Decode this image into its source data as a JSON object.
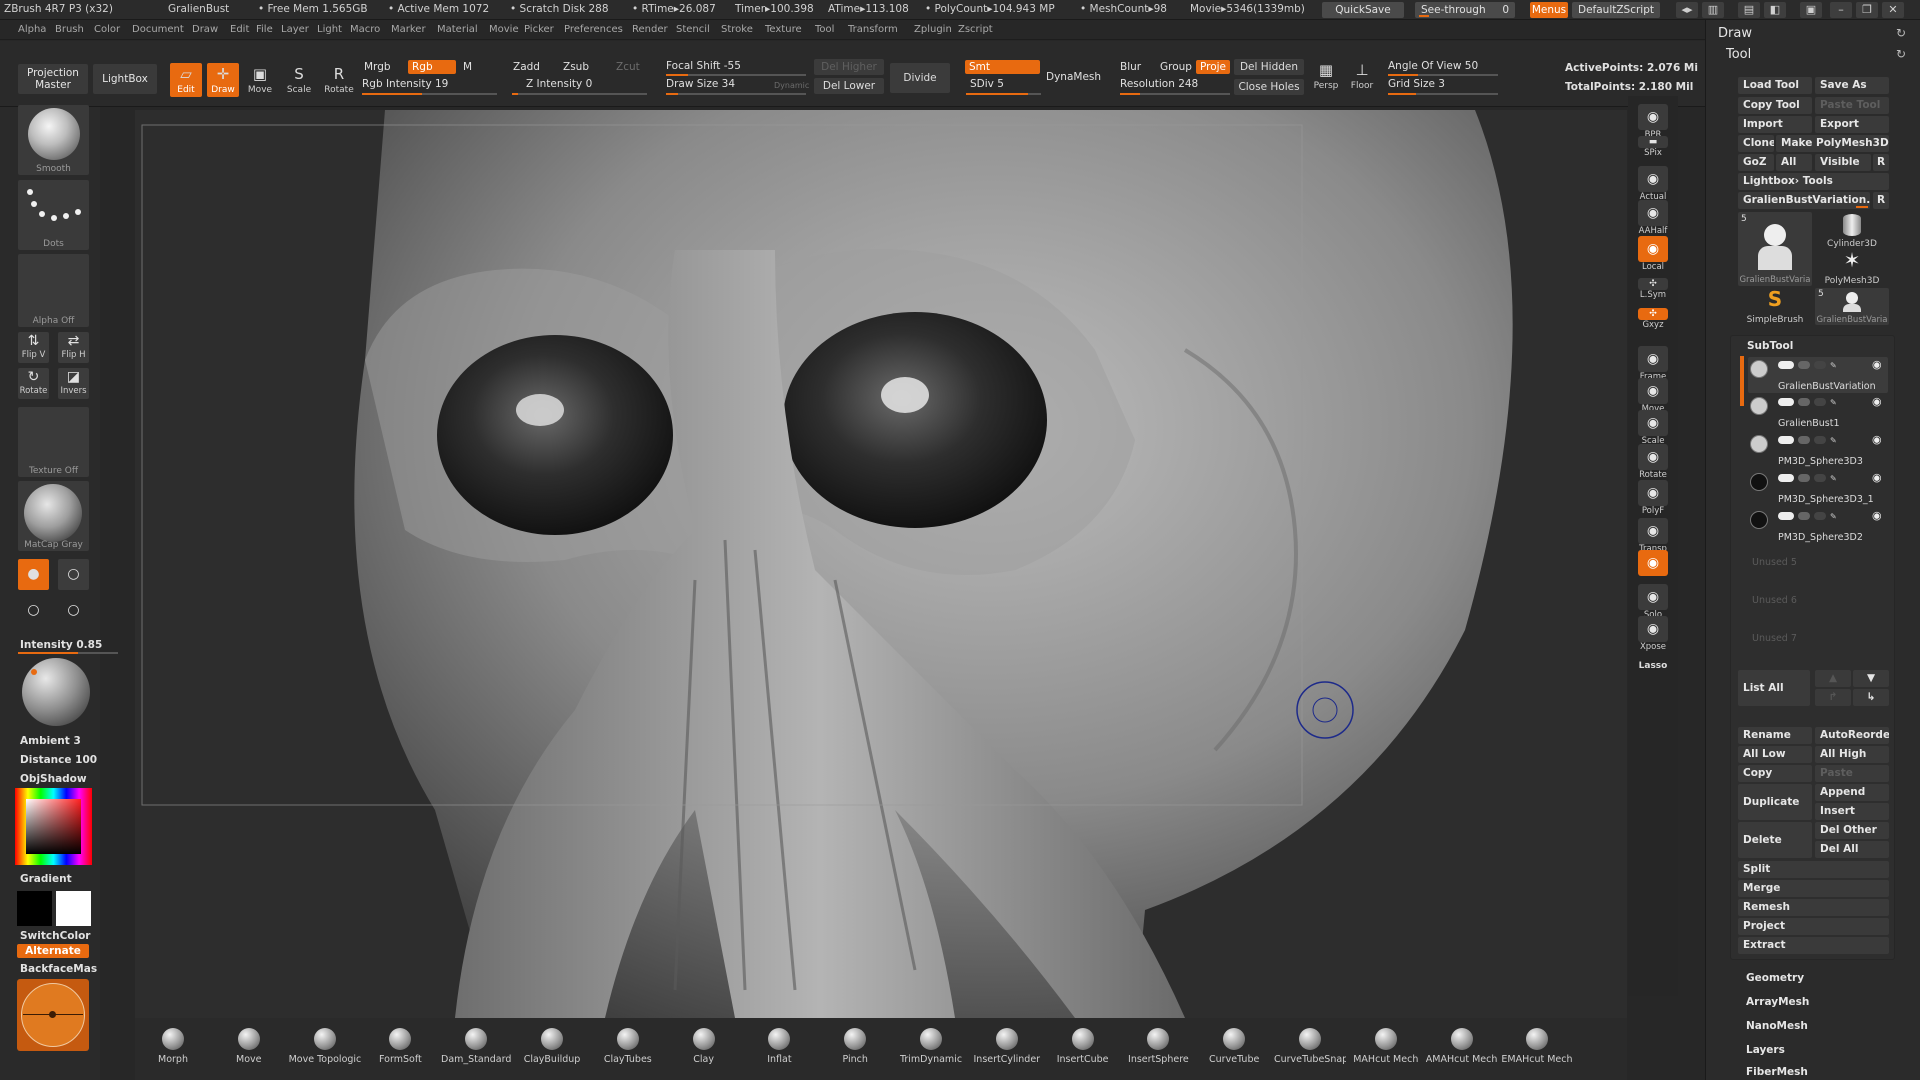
{
  "titlebar": {
    "app": "ZBrush 4R7 P3 (x32)",
    "doc": "GralienBust",
    "free_mem": "• Free Mem 1.565GB",
    "active_mem": "• Active Mem 1072",
    "scratch": "• Scratch Disk 288",
    "rtime": "• RTime▸26.087",
    "timer": "Timer▸100.398",
    "atime": "ATime▸113.108",
    "polycount": "• PolyCount▸104.943 MP",
    "meshcount": "• MeshCount▸98",
    "movie": "Movie▸5346(1339mb)",
    "quicksave": "QuickSave",
    "seethrough": "See-through",
    "seethrough_val": "0",
    "menus": "Menus",
    "zscript": "DefaultZScript"
  },
  "menubar": [
    "Alpha",
    "Brush",
    "Color",
    "Document",
    "Draw",
    "Edit",
    "File",
    "Layer",
    "Light",
    "Macro",
    "Marker",
    "Material",
    "Movie",
    "Picker",
    "Preferences",
    "Render",
    "Stencil",
    "Stroke",
    "Texture",
    "Tool",
    "Transform",
    "Zplugin",
    "Zscript"
  ],
  "topshelf": {
    "projection_master": "Projection Master",
    "lightbox": "LightBox",
    "edit": "Edit",
    "draw": "Draw",
    "move": "Move",
    "scale": "Scale",
    "rotate": "Rotate",
    "mrgb": "Mrgb",
    "rgb": "Rgb",
    "m": "M",
    "rgb_intensity": "Rgb Intensity 19",
    "zadd": "Zadd",
    "zsub": "Zsub",
    "zcut": "Zcut",
    "z_intensity": "Z Intensity 0",
    "focal_shift": "Focal Shift -55",
    "draw_size": "Draw Size 34",
    "dynamic": "Dynamic",
    "del_higher": "Del Higher",
    "del_lower": "Del Lower",
    "divide": "Divide",
    "smt": "Smt",
    "sdiv": "SDiv 5",
    "dynamesh": "DynaMesh",
    "blur": "Blur",
    "group": "Group",
    "proje": "Proje",
    "resolution": "Resolution 248",
    "del_hidden": "Del Hidden",
    "close_holes": "Close Holes",
    "persp": "Persp",
    "floor": "Floor",
    "angle_of_view": "Angle Of View 50",
    "grid_size": "Grid Size 3",
    "active_points": "ActivePoints: 2.076  Mi",
    "total_points": "TotalPoints: 2.180  Mil"
  },
  "leftpanel": {
    "smooth": "Smooth",
    "dots": "Dots",
    "alpha_off": "Alpha Off",
    "flip_v": "Flip V",
    "flip_h": "Flip H",
    "rotate": "Rotate",
    "invers": "Invers",
    "texture_off": "Texture Off",
    "matcap": "MatCap Gray",
    "intensity": "Intensity 0.85",
    "ambient": "Ambient 3",
    "distance": "Distance 100",
    "objshadow": "ObjShadow",
    "gradient": "Gradient",
    "switchcolor": "SwitchColor",
    "alternate": "Alternate",
    "backface": "BackfaceMas"
  },
  "rightshelf": [
    {
      "name": "bpr",
      "label": "BPR",
      "on": false
    },
    {
      "name": "spix",
      "label": "SPix",
      "on": false
    },
    {
      "name": "actual",
      "label": "Actual",
      "on": false
    },
    {
      "name": "aahalf",
      "label": "AAHalf",
      "on": false
    },
    {
      "name": "local",
      "label": "Local",
      "on": true
    },
    {
      "name": "lsym",
      "label": "L.Sym",
      "on": false
    },
    {
      "name": "xyz",
      "label": "Gxyz",
      "on": true
    },
    {
      "name": "frame",
      "label": "Frame",
      "on": false
    },
    {
      "name": "move",
      "label": "Move",
      "on": false
    },
    {
      "name": "scale",
      "label": "Scale",
      "on": false
    },
    {
      "name": "rotate",
      "label": "Rotate",
      "on": false
    },
    {
      "name": "polyf",
      "label": "PolyF",
      "on": false
    },
    {
      "name": "transp",
      "label": "Transp",
      "on": false
    },
    {
      "name": "ghost",
      "label": "",
      "on": true
    },
    {
      "name": "solo",
      "label": "Solo",
      "on": false
    },
    {
      "name": "xpose",
      "label": "Xpose",
      "on": false
    }
  ],
  "rightshelf_lasso": "Lasso",
  "brushes": [
    "Morph",
    "Move",
    "Move Topologic",
    "FormSoft",
    "Dam_Standard",
    "ClayBuildup",
    "ClayTubes",
    "Clay",
    "Inflat",
    "Pinch",
    "TrimDynamic",
    "InsertCylinder",
    "InsertCube",
    "InsertSphere",
    "CurveTube",
    "CurveTubeSnap",
    "MAHcut Mech",
    "AMAHcut Mech",
    "EMAHcut Mech C"
  ],
  "tool": {
    "draw_title": "Draw",
    "tool_title": "Tool",
    "load_tool": "Load Tool",
    "save_as": "Save As",
    "copy_tool": "Copy Tool",
    "paste_tool": "Paste Tool",
    "import": "Import",
    "export": "Export",
    "clone": "Clone",
    "make_polymesh": "Make PolyMesh3D",
    "goz": "GoZ",
    "all": "All",
    "visible": "Visible",
    "r": "R",
    "lightbox_tools": "Lightbox› Tools",
    "current_tool": "GralienBustVariation.",
    "thumbs": [
      "GralienBustVaria",
      "Cylinder3D",
      "PolyMesh3D",
      "SimpleBrush",
      "GralienBustVaria"
    ],
    "thumb_counts": [
      "5",
      "5"
    ],
    "subtool_title": "SubTool",
    "subtools": [
      "GralienBustVariation",
      "GralienBust1",
      "PM3D_Sphere3D3",
      "PM3D_Sphere3D3_1",
      "PM3D_Sphere3D2"
    ],
    "unused": [
      "Unused 5",
      "Unused 6",
      "Unused 7"
    ],
    "list_all": "List All",
    "rename": "Rename",
    "autoreorder": "AutoReorde",
    "all_low": "All Low",
    "all_high": "All High",
    "copy": "Copy",
    "paste": "Paste",
    "duplicate": "Duplicate",
    "append": "Append",
    "insert": "Insert",
    "delete": "Delete",
    "del_other": "Del Other",
    "del_all": "Del All",
    "split": "Split",
    "merge": "Merge",
    "remesh": "Remesh",
    "project": "Project",
    "extract": "Extract",
    "geometry": "Geometry",
    "arraymesh": "ArrayMesh",
    "nanomesh": "NanoMesh",
    "layers": "Layers",
    "fibermesh": "FiberMesh"
  },
  "colors": {
    "accent": "#e86a10",
    "panel": "#2a2a2a",
    "button": "#3a3a3a"
  }
}
